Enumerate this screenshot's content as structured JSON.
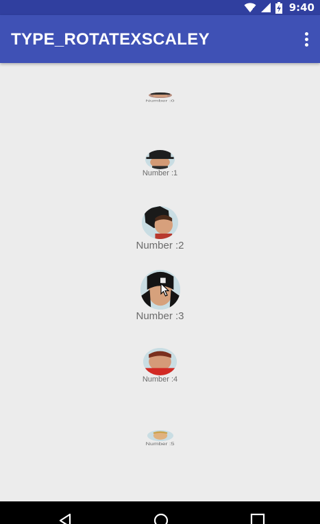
{
  "status_bar": {
    "time": "9:40",
    "icons": [
      "wifi-icon",
      "signal-icon",
      "battery-charging-icon"
    ]
  },
  "app_bar": {
    "title": "TYPE_ROTATEXSCALEY",
    "menu_icon": "overflow-menu-icon"
  },
  "list": {
    "items": [
      {
        "label": "Number :0"
      },
      {
        "label": "Number :1"
      },
      {
        "label": "Number :2"
      },
      {
        "label": "Number :3"
      },
      {
        "label": "Number :4"
      },
      {
        "label": "Number :5"
      }
    ]
  },
  "nav_bar": {
    "icons": [
      "back-icon",
      "home-icon",
      "recents-icon"
    ]
  },
  "colors": {
    "status_bar": "#303f9f",
    "app_bar": "#3f51b5",
    "background": "#ececec",
    "label": "#6b6b6b",
    "nav_bar": "#000000"
  }
}
